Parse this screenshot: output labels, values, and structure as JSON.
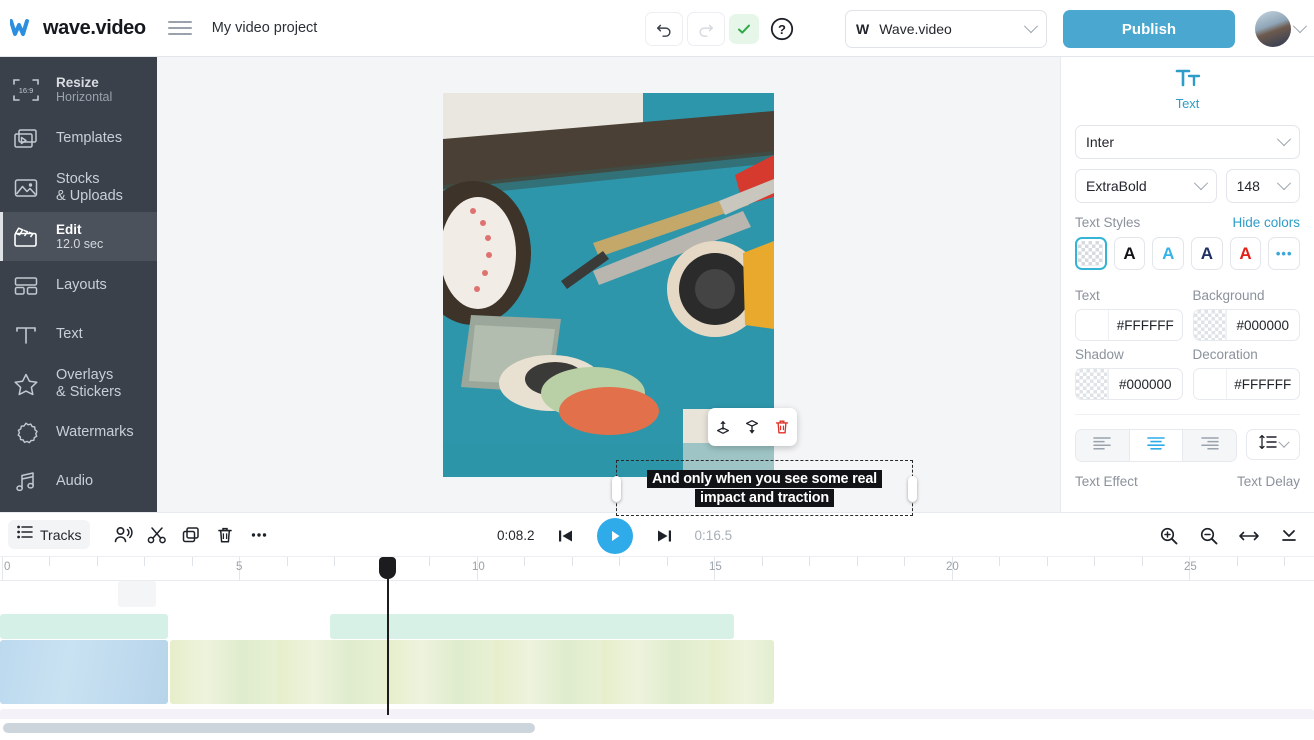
{
  "header": {
    "brand_name": "wave.video",
    "logo_icon": "wave-w-logo",
    "menu_icon": "hamburger-menu-icon",
    "project_title": "My video project",
    "undo_icon": "undo-arrow-icon",
    "redo_icon": "redo-arrow-icon",
    "saved_icon": "checkmark-saved-icon",
    "help_icon": "question-mark-help-icon",
    "brand_selector": {
      "mark": "W",
      "label": "Wave.video",
      "chevron_icon": "chevron-down-icon"
    },
    "publish_label": "Publish",
    "avatar_icon": "user-avatar",
    "avatar_chevron_icon": "chevron-down-icon"
  },
  "sidebar": {
    "items": [
      {
        "label": "Resize",
        "sub": "Horizontal",
        "icon": "resize-16-9-icon",
        "active": false
      },
      {
        "label": "Templates",
        "sub": "",
        "icon": "templates-icon",
        "active": false
      },
      {
        "label": "Stocks",
        "sub": "& Uploads",
        "icon": "image-stocks-icon",
        "active": false
      },
      {
        "label": "Edit",
        "sub": "12.0 sec",
        "icon": "clapperboard-edit-icon",
        "active": true
      },
      {
        "label": "Layouts",
        "sub": "",
        "icon": "layouts-grid-icon",
        "active": false
      },
      {
        "label": "Text",
        "sub": "",
        "icon": "text-t-icon",
        "active": false
      },
      {
        "label": "Overlays",
        "sub": "& Stickers",
        "icon": "star-overlays-icon",
        "active": false
      },
      {
        "label": "Watermarks",
        "sub": "",
        "icon": "badge-watermark-icon",
        "active": false
      },
      {
        "label": "Audio",
        "sub": "",
        "icon": "music-note-audio-icon",
        "active": false
      }
    ],
    "resize_ratio": "16:9"
  },
  "canvas": {
    "scene_description": "craft desk with washi tape rolls, scissors, rotary cutter and cutting mat on teal background",
    "float_toolbar": {
      "bring_forward_icon": "bring-to-front-icon",
      "send_backward_icon": "send-to-back-icon",
      "delete_icon": "trash-delete-icon"
    },
    "text_overlay": {
      "line1": "And only when you see some real",
      "line2": "impact and traction",
      "handle_left_icon": "resize-handle-left",
      "handle_right_icon": "resize-handle-right"
    }
  },
  "right_panel": {
    "panel_icon": "text-tt-icon",
    "panel_title": "Text",
    "font_family": "Inter",
    "font_weight": "ExtraBold",
    "font_size": "148",
    "text_styles_label": "Text Styles",
    "hide_colors_label": "Hide colors",
    "text_styles": [
      {
        "name": "style-transparent",
        "glyph": "",
        "color": "",
        "selected": true
      },
      {
        "name": "style-black",
        "glyph": "A",
        "color": "#111316",
        "selected": false
      },
      {
        "name": "style-lightblue",
        "glyph": "A",
        "color": "#35b4e8",
        "selected": false
      },
      {
        "name": "style-navy",
        "glyph": "A",
        "color": "#1f3061",
        "selected": false
      },
      {
        "name": "style-red",
        "glyph": "A",
        "color": "#e32119",
        "selected": false
      },
      {
        "name": "style-more",
        "glyph": "•••",
        "color": "#3aa7d6",
        "selected": false
      }
    ],
    "colors": [
      {
        "label": "Text",
        "value": "#FFFFFF",
        "swatch": "white"
      },
      {
        "label": "Background",
        "value": "#000000",
        "swatch": "transparent"
      },
      {
        "label": "Shadow",
        "value": "#000000",
        "swatch": "transparent"
      },
      {
        "label": "Decoration",
        "value": "#FFFFFF",
        "swatch": "white"
      }
    ],
    "align": [
      {
        "name": "align-left",
        "icon": "align-left-icon",
        "selected": false
      },
      {
        "name": "align-center",
        "icon": "align-center-icon",
        "selected": true
      },
      {
        "name": "align-right",
        "icon": "align-right-icon",
        "selected": false
      }
    ],
    "line_height_icon": "line-height-icon",
    "line_height_chevron_icon": "chevron-down-icon",
    "text_effect_label": "Text Effect",
    "text_delay_label": "Text Delay",
    "accent_color": "#2e9cc9"
  },
  "timeline": {
    "tracks_label": "Tracks",
    "tools": [
      {
        "name": "voiceover-button",
        "icon": "voiceover-icon"
      },
      {
        "name": "split-button",
        "icon": "scissors-split-icon"
      },
      {
        "name": "duplicate-button",
        "icon": "duplicate-copy-icon"
      },
      {
        "name": "delete-button",
        "icon": "trash-delete-icon"
      },
      {
        "name": "more-button",
        "icon": "more-dots-icon"
      }
    ],
    "current_time": "0:08.2",
    "total_time": "0:16.5",
    "prev_icon": "skip-previous-icon",
    "play_icon": "play-icon",
    "next_icon": "skip-next-icon",
    "zoom_in_icon": "zoom-in-icon",
    "zoom_out_icon": "zoom-out-icon",
    "fit_icon": "fit-width-icon",
    "collapse_icon": "collapse-down-icon",
    "ruler_labels": [
      "0",
      "5",
      "10",
      "15",
      "20",
      "25"
    ],
    "playhead_time": "0:08.2",
    "accent_color": "#2eabe8"
  }
}
